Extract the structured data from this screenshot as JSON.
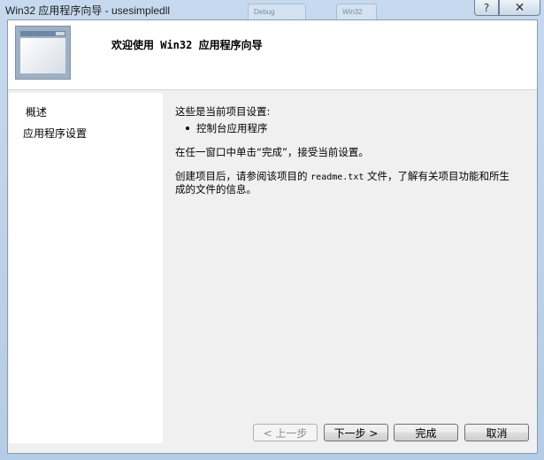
{
  "window": {
    "title": "Win32 应用程序向导 - usesimpledll",
    "help_label": "?",
    "close_label": "✕",
    "bg_tabs": [
      "Debug",
      "Win32"
    ]
  },
  "header": {
    "title": "欢迎使用 Win32 应用程序向导"
  },
  "sidebar": {
    "items": [
      {
        "label": "概述"
      },
      {
        "label": "应用程序设置"
      }
    ]
  },
  "main": {
    "intro": "这些是当前项目设置:",
    "bullet": "控制台应用程序",
    "finish_hint": "在任一窗口中单击“完成”，接受当前设置。",
    "readme_pre": "创建项目后，请参阅该项目的",
    "readme_file": "readme.txt",
    "readme_post": "文件，了解有关项目功能和所生",
    "readme_line2": "成的文件的信息。"
  },
  "buttons": {
    "back": "< 上一步",
    "next": "下一步 >",
    "finish": "完成",
    "cancel": "取消"
  }
}
